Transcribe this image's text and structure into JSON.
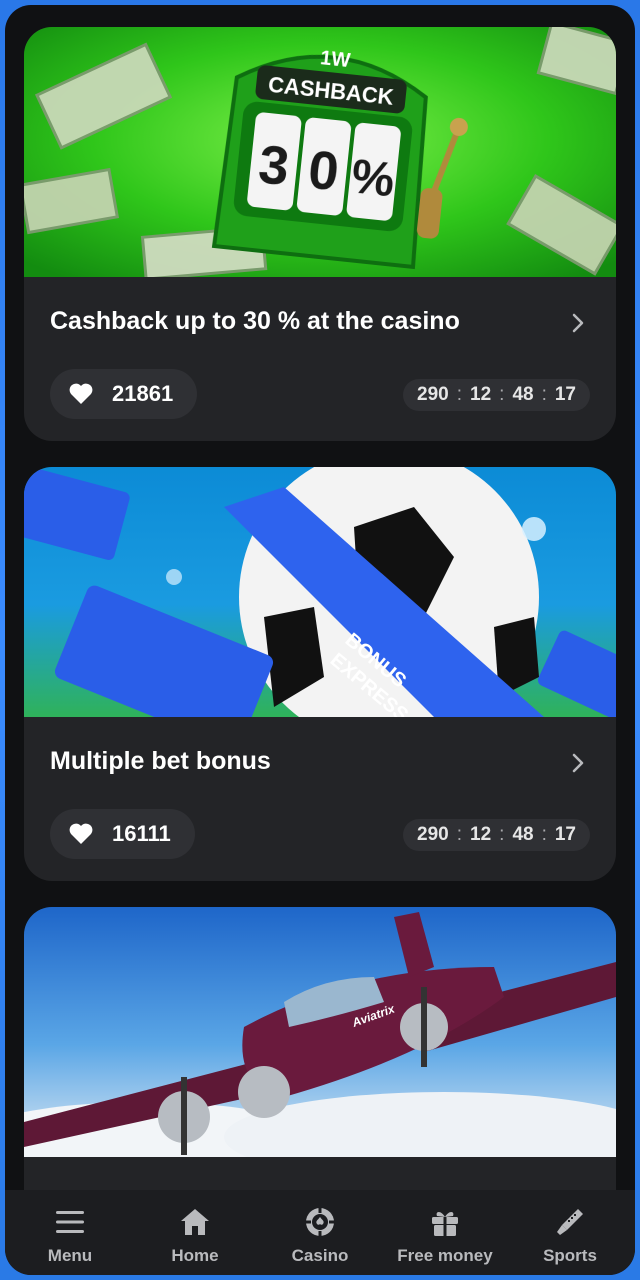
{
  "promos": [
    {
      "banner": {
        "brand": "1W",
        "headline": "CASHBACK",
        "reels": [
          "3",
          "0",
          "%"
        ]
      },
      "title": "Cashback up to 30 % at the casino",
      "likes": "21861",
      "timer": [
        "290",
        "12",
        "48",
        "17"
      ],
      "timer_separator": ":",
      "accent": "#2fc61a"
    },
    {
      "banner": {
        "ticket_text": [
          "BONUS",
          "EXPRESS"
        ]
      },
      "title": "Multiple bet bonus",
      "likes": "16111",
      "timer": [
        "290",
        "12",
        "48",
        "17"
      ],
      "timer_separator": ":",
      "accent": "#1f63e0"
    },
    {
      "banner": {
        "plane_text": "Aviatrix"
      }
    }
  ],
  "nav": {
    "items": [
      {
        "label": "Menu",
        "icon": "menu-icon"
      },
      {
        "label": "Home",
        "icon": "home-icon"
      },
      {
        "label": "Casino",
        "icon": "casino-chip-icon"
      },
      {
        "label": "Free money",
        "icon": "gift-icon"
      },
      {
        "label": "Sports",
        "icon": "sports-icon"
      }
    ]
  },
  "colors": {
    "frame": "#2a78e8",
    "background": "#101113",
    "card": "#232427",
    "pill": "#2f3034",
    "nav_bg": "#1c1d20",
    "nav_text": "#b9babd"
  }
}
